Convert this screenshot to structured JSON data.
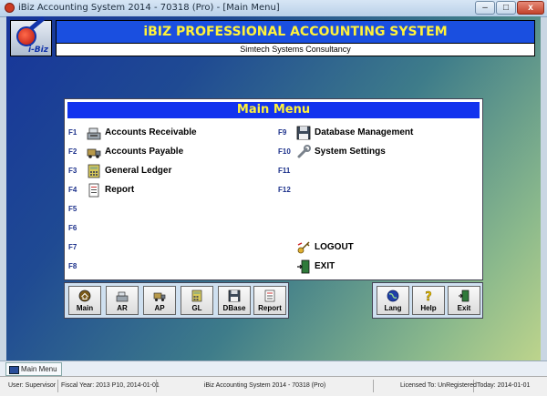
{
  "window": {
    "title": "iBiz Accounting System 2014 - 70318 (Pro) - [Main Menu]",
    "minimize": "–",
    "maximize": "□",
    "close": "x"
  },
  "header": {
    "logo_text": "i-Biz",
    "title": "iBIZ PROFESSIONAL ACCOUNTING SYSTEM",
    "subtitle": "Simtech Systems Consultancy"
  },
  "main_menu": {
    "title": "Main Menu",
    "left_items": [
      {
        "key": "F1",
        "label": "Accounts Receivable",
        "icon": "cash-register-icon"
      },
      {
        "key": "F2",
        "label": "Accounts Payable",
        "icon": "truck-icon"
      },
      {
        "key": "F3",
        "label": "General Ledger",
        "icon": "calculator-icon"
      },
      {
        "key": "F4",
        "label": "Report",
        "icon": "report-icon"
      },
      {
        "key": "F5",
        "label": ""
      },
      {
        "key": "F6",
        "label": ""
      },
      {
        "key": "F7",
        "label": ""
      },
      {
        "key": "F8",
        "label": ""
      }
    ],
    "right_items": [
      {
        "key": "F9",
        "label": "Database Management",
        "icon": "floppy-disk-icon"
      },
      {
        "key": "F10",
        "label": "System Settings",
        "icon": "wrench-icon"
      },
      {
        "key": "F11",
        "label": ""
      },
      {
        "key": "F12",
        "label": ""
      }
    ],
    "logout_label": "LOGOUT",
    "exit_label": "EXIT"
  },
  "toolbar": {
    "main": "Main",
    "ar": "AR",
    "ap": "AP",
    "gl": "GL",
    "dbase": "DBase",
    "report": "Report",
    "lang": "Lang",
    "help": "Help",
    "exit": "Exit"
  },
  "taskbar": {
    "tab": "Main Menu"
  },
  "status": {
    "user": "User: Supervisor",
    "fiscal": "Fiscal Year: 2013 P10, 2014-01-01",
    "app": "iBiz Accounting System 2014 - 70318 (Pro)",
    "license": "Licensed To: UnRegistered",
    "today": "Today: 2014-01-01"
  }
}
